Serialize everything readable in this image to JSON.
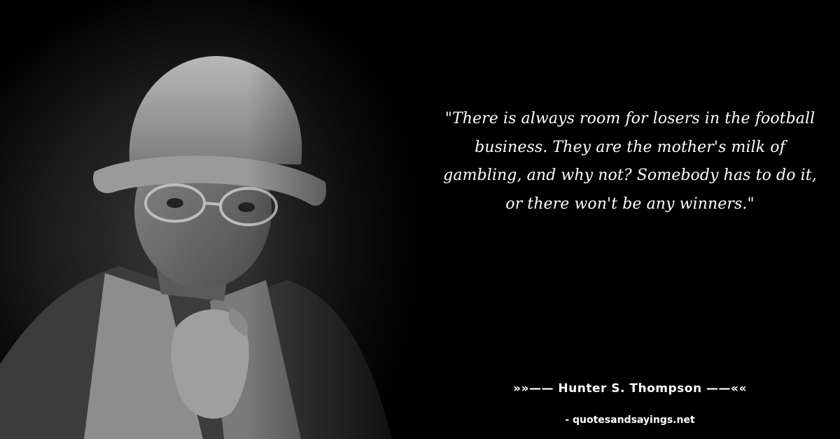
{
  "quote": {
    "text": "\"There is always room for losers in the football business. They are the mother's milk of gambling, and why not? Somebody has to do it, or there won't be any winners.\""
  },
  "author": {
    "line": "»»—— Hunter S. Thompson ——««"
  },
  "source": {
    "site": "- quotesandsayings.net"
  },
  "colors": {
    "background": "#000000",
    "text": "#ffffff"
  }
}
